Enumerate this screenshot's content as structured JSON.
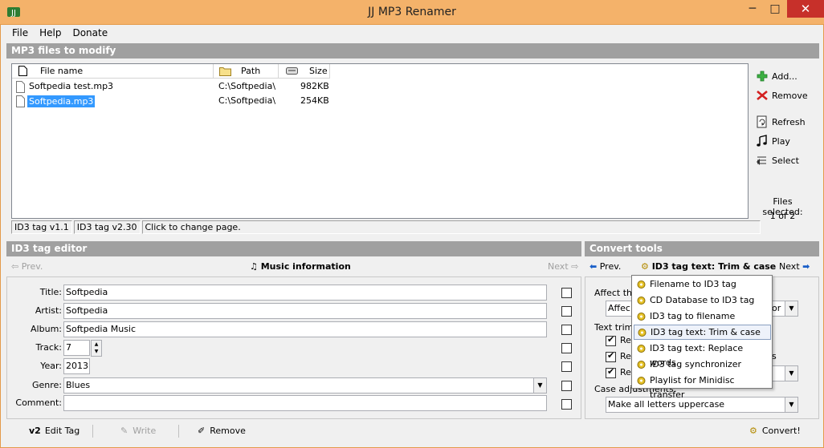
{
  "window": {
    "title": "JJ MP3 Renamer",
    "min": "─",
    "max": "□",
    "close": "✕"
  },
  "menu": [
    "File",
    "Help",
    "Donate"
  ],
  "files_section": {
    "header": "MP3 files to modify",
    "columns": [
      "File name",
      "Path",
      "Size"
    ],
    "rows": [
      {
        "name": "Softpedia test.mp3",
        "path": "C:\\Softpedia\\",
        "size": "982KB"
      },
      {
        "name": "Softpedia.mp3",
        "path": "C:\\Softpedia\\",
        "size": "254KB"
      }
    ],
    "status": [
      "ID3 tag v1.1",
      "ID3 tag v2.30",
      "Click to change page."
    ]
  },
  "side_buttons": {
    "add": "Add...",
    "remove": "Remove",
    "refresh": "Refresh",
    "play": "Play",
    "select": "Select"
  },
  "files_selected": {
    "label": "Files selected:",
    "value": "1 of 2"
  },
  "editor": {
    "header": "ID3 tag editor",
    "prev": "Prev.",
    "next": "Next",
    "page_title": "Music information",
    "labels": {
      "title": "Title:",
      "artist": "Artist:",
      "album": "Album:",
      "track": "Track:",
      "year": "Year:",
      "genre": "Genre:",
      "comment": "Comment:"
    },
    "values": {
      "title": "Softpedia",
      "artist": "Softpedia",
      "album": "Softpedia Music",
      "track": "7",
      "year": "2013",
      "genre": "Blues",
      "comment": ""
    },
    "bottom": {
      "v2": "v2",
      "edit": "Edit Tag",
      "write": "Write",
      "remove": "Remove"
    }
  },
  "convert": {
    "header": "Convert tools",
    "prev": "Prev.",
    "next": "Next",
    "page_title": "ID3 tag text: Trim & case",
    "affect_label": "Affect thi",
    "affect_value": "Affec",
    "affect_tail": "or",
    "trim_label": "Text trimi",
    "opt1": "Rer",
    "opt2": "Rer",
    "opt2_tail": "ls",
    "opt3": "Rer",
    "opt3_tail": "t",
    "case_label": "Case adjustments:",
    "case_value": "Make all letters uppercase",
    "convert_btn": "Convert!",
    "menu_items": [
      "Filename to ID3 tag",
      "CD Database to ID3 tag",
      "ID3 tag to filename",
      "ID3 tag text: Trim & case",
      "ID3 tag text: Replace words",
      "ID3 tag synchronizer",
      "Playlist for Minidisc transfer"
    ]
  },
  "colors": {
    "titlebar": "#f4b26a",
    "close": "#c7302a",
    "section": "#a0a0a0",
    "selection": "#3399ff",
    "nav_arrow": "#1a5fc8"
  }
}
